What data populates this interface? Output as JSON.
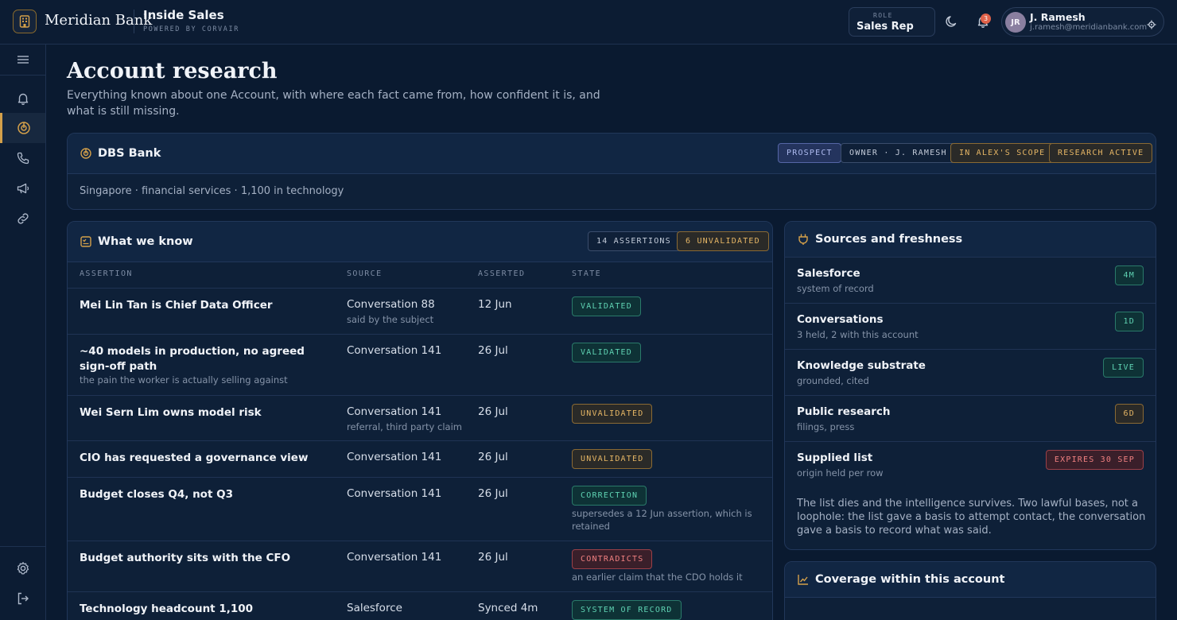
{
  "header": {
    "brand": "Meridian Bank",
    "app_title": "Inside Sales",
    "app_subtitle": "POWERED BY CORVAIR",
    "role_label": "ROLE",
    "role_value": "Sales Rep",
    "notifications_count": "3",
    "user_initials": "JR",
    "user_name": "J. Ramesh",
    "user_email": "j.ramesh@meridianbank.com"
  },
  "sidebar": {
    "items": [
      "menu-icon",
      "bell-icon",
      "target-icon",
      "phone-icon",
      "megaphone-icon",
      "link-icon"
    ],
    "active": "target-icon",
    "bottom": [
      "settings-icon",
      "logout-icon"
    ]
  },
  "page": {
    "title": "Account research",
    "description": "Everything known about one Account, with where each fact came from, how confident it is, and what is still missing."
  },
  "account": {
    "name": "DBS Bank",
    "tags": [
      "PROSPECT",
      "OWNER · J. RAMESH",
      "IN ALEX'S SCOPE",
      "RESEARCH ACTIVE"
    ],
    "meta": "Singapore · financial services · 1,100 in technology"
  },
  "what_we_know": {
    "title": "What we know",
    "count_tag": "14 ASSERTIONS",
    "unvalidated_tag": "6 UNVALIDATED",
    "columns": [
      "ASSERTION",
      "SOURCE",
      "ASSERTED",
      "STATE"
    ],
    "rows": [
      {
        "assertion": "Mei Lin Tan is Chief Data Officer",
        "note": "",
        "source": "Conversation 88",
        "source_note": "said by the subject",
        "date": "12 Jun",
        "state": "VALIDATED",
        "state_note": ""
      },
      {
        "assertion": "~40 models in production, no agreed sign-off path",
        "note": "the pain the worker is actually selling against",
        "source": "Conversation 141",
        "source_note": "",
        "date": "26 Jul",
        "state": "VALIDATED",
        "state_note": ""
      },
      {
        "assertion": "Wei Sern Lim owns model risk",
        "note": "",
        "source": "Conversation 141",
        "source_note": "referral, third party claim",
        "date": "26 Jul",
        "state": "UNVALIDATED",
        "state_note": ""
      },
      {
        "assertion": "CIO has requested a governance view",
        "note": "",
        "source": "Conversation 141",
        "source_note": "",
        "date": "26 Jul",
        "state": "UNVALIDATED",
        "state_note": ""
      },
      {
        "assertion": "Budget closes Q4, not Q3",
        "note": "",
        "source": "Conversation 141",
        "source_note": "",
        "date": "26 Jul",
        "state": "CORRECTION",
        "state_note": "supersedes a 12 Jun assertion, which is retained"
      },
      {
        "assertion": "Budget authority sits with the CFO",
        "note": "",
        "source": "Conversation 141",
        "source_note": "",
        "date": "26 Jul",
        "state": "CONTRADICTS",
        "state_note": "an earlier claim that the CDO holds it"
      },
      {
        "assertion": "Technology headcount 1,100",
        "note": "",
        "source": "Salesforce",
        "source_note": "",
        "date": "Synced 4m",
        "state": "SYSTEM OF RECORD",
        "state_note": ""
      }
    ]
  },
  "sources": {
    "title": "Sources and freshness",
    "items": [
      {
        "name": "Salesforce",
        "sub": "system of record",
        "tag": "4M",
        "tone": "green"
      },
      {
        "name": "Conversations",
        "sub": "3 held, 2 with this account",
        "tag": "1D",
        "tone": "green"
      },
      {
        "name": "Knowledge substrate",
        "sub": "grounded, cited",
        "tag": "LIVE",
        "tone": "green"
      },
      {
        "name": "Public research",
        "sub": "filings, press",
        "tag": "6D",
        "tone": "gold"
      },
      {
        "name": "Supplied list",
        "sub": "origin held per row",
        "tag": "EXPIRES 30 SEP",
        "tone": "red"
      }
    ],
    "note": "The list dies and the intelligence survives. Two lawful bases, not a loophole: the list gave a basis to attempt contact, the conversation gave a basis to record what was said."
  },
  "coverage": {
    "title": "Coverage within this account"
  }
}
